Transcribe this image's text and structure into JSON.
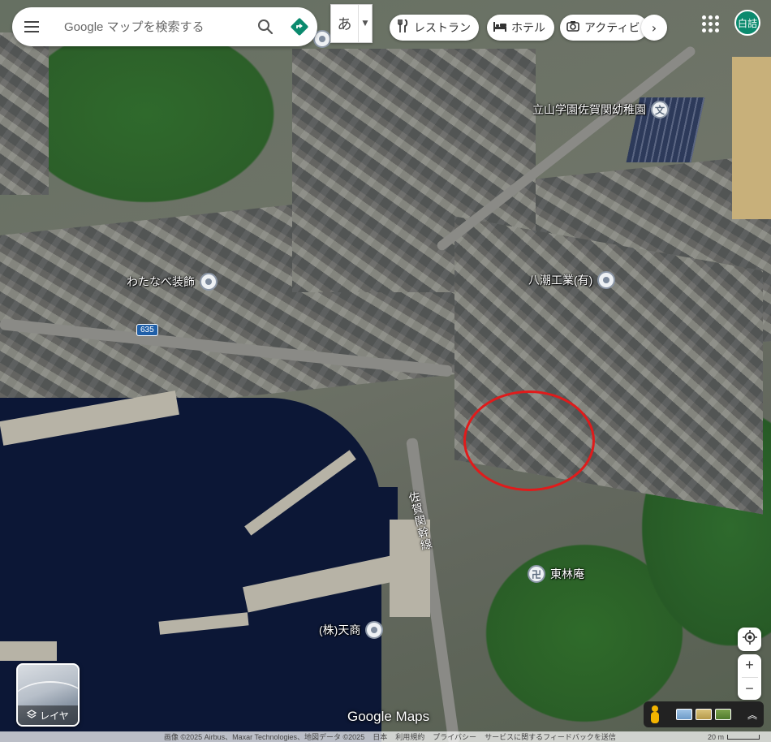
{
  "search": {
    "placeholder": "Google マップを検索する"
  },
  "ime": {
    "char": "あ"
  },
  "chips": [
    {
      "icon": "fork-knife-icon",
      "glyph": "🍴",
      "label": "レストラン"
    },
    {
      "icon": "bed-icon",
      "glyph": "🛏",
      "label": "ホテル"
    },
    {
      "icon": "camera-icon",
      "glyph": "📷",
      "label": "アクティビ"
    }
  ],
  "account": {
    "initials": "白詰"
  },
  "places": [
    {
      "name": "立山学園佐賀関幼稚園",
      "icon": "school-icon",
      "glyph": "文"
    },
    {
      "name": "わたなべ装飾",
      "icon": "place-pin-icon",
      "glyph": ""
    },
    {
      "name": "八潮工業(有)",
      "icon": "place-pin-icon",
      "glyph": ""
    },
    {
      "name": "東林庵",
      "icon": "temple-icon",
      "glyph": "卍"
    },
    {
      "name": "(株)天商",
      "icon": "place-pin-icon",
      "glyph": ""
    }
  ],
  "road": {
    "route_number": "635",
    "name": "佐賀関幹線"
  },
  "layers": {
    "label": "レイヤ"
  },
  "controls": {
    "zoom_in": "+",
    "zoom_out": "−"
  },
  "branding": {
    "logo": "Google Maps"
  },
  "attribution": {
    "imagery": "画像 ©2025 Airbus、Maxar Technologies、地図データ ©2025",
    "country": "日本",
    "terms": "利用規約",
    "privacy": "プライバシー",
    "feedback": "サービスに関するフィードバックを送信",
    "scale": "20 m"
  },
  "colors": {
    "highlight_circle": "#e01b1b",
    "avatar": "#0b8a6e",
    "route_badge": "#1f5fa8"
  }
}
